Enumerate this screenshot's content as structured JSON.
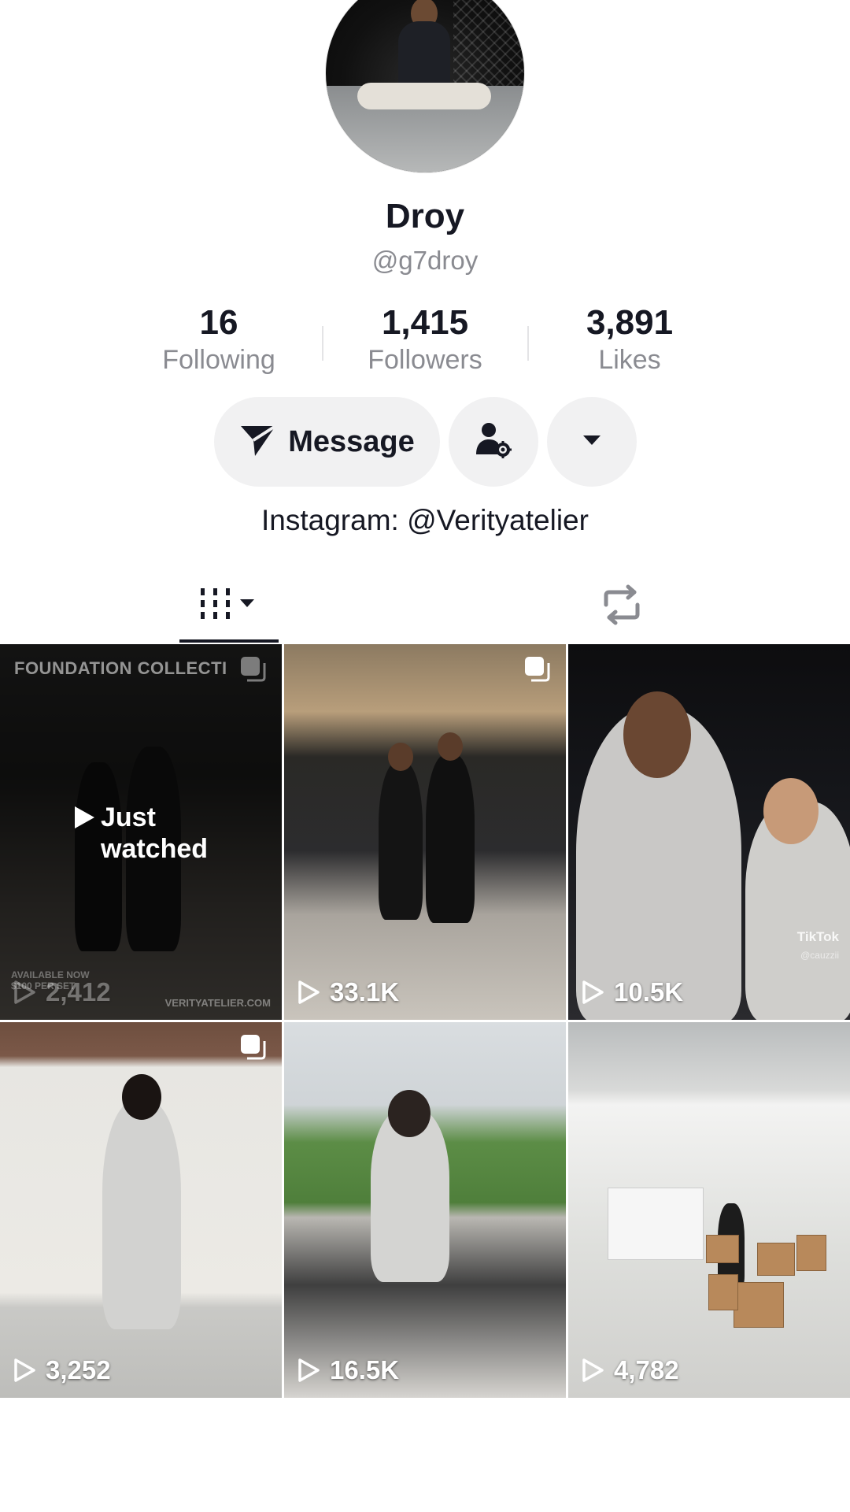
{
  "profile": {
    "display_name": "Droy",
    "username": "@g7droy",
    "bio": "Instagram: @Verityatelier"
  },
  "stats": [
    {
      "value": "16",
      "label": "Following"
    },
    {
      "value": "1,415",
      "label": "Followers"
    },
    {
      "value": "3,891",
      "label": "Likes"
    }
  ],
  "actions": {
    "message_label": "Message"
  },
  "tabs": {
    "videos_icon": "grid-filter-icon",
    "repost_icon": "repost-icon"
  },
  "videos": [
    {
      "views": "2,412",
      "overlay_line1": "Just",
      "overlay_line2": "watched",
      "caption_text": "FOUNDATION COLLECTI",
      "watermark": "VERITYATELIER.COM",
      "watermark_left_1": "AVAILABLE NOW",
      "watermark_left_2": "$100 PER SET"
    },
    {
      "views": "33.1K"
    },
    {
      "views": "10.5K",
      "tiktok_mark": "TikTok",
      "tiktok_user": "@cauzzii"
    },
    {
      "views": "3,252"
    },
    {
      "views": "16.5K"
    },
    {
      "views": "4,782"
    }
  ],
  "colors": {
    "text_primary": "#161823",
    "text_secondary": "#8a8b91",
    "button_bg": "#f1f1f2"
  }
}
